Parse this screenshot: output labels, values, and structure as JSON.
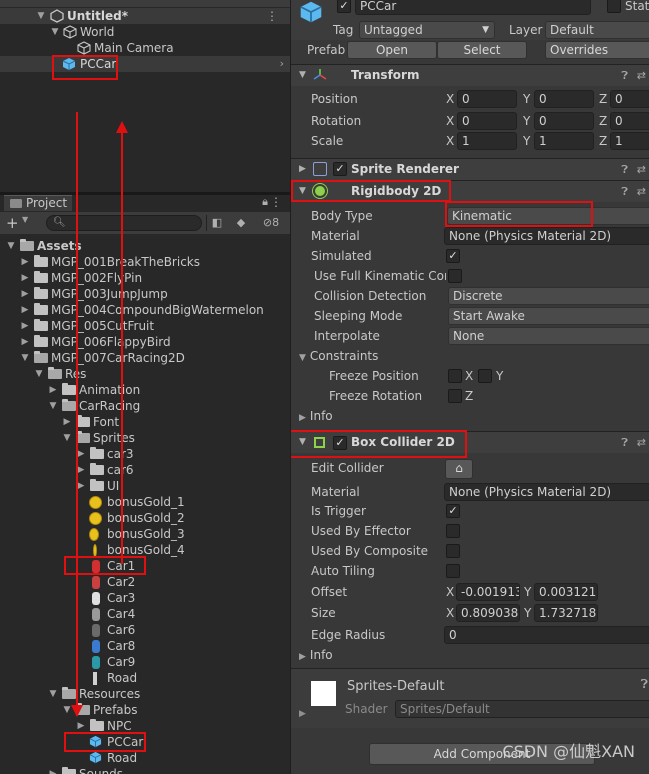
{
  "hierarchy": {
    "scene_name": "Untitled*",
    "items": [
      {
        "label": "World"
      },
      {
        "label": "Main Camera"
      },
      {
        "label": "PCCar"
      }
    ]
  },
  "project": {
    "tab_label": "Project",
    "badge_count": "8",
    "tree": [
      {
        "label": "Assets"
      },
      {
        "label": "MGP_001BreakTheBricks"
      },
      {
        "label": "MGP_002FlyPin"
      },
      {
        "label": "MGP_003JumpJump"
      },
      {
        "label": "MGP_004CompoundBigWatermelon"
      },
      {
        "label": "MGP_005CutFruit"
      },
      {
        "label": "MGP_006FlappyBird"
      },
      {
        "label": "MGP_007CarRacing2D"
      },
      {
        "label": "Res"
      },
      {
        "label": "Animation"
      },
      {
        "label": "CarRacing"
      },
      {
        "label": "Font"
      },
      {
        "label": "Sprites"
      },
      {
        "label": "car3"
      },
      {
        "label": "car6"
      },
      {
        "label": "UI"
      },
      {
        "label": "bonusGold_1"
      },
      {
        "label": "bonusGold_2"
      },
      {
        "label": "bonusGold_3"
      },
      {
        "label": "bonusGold_4"
      },
      {
        "label": "Car1"
      },
      {
        "label": "Car2"
      },
      {
        "label": "Car3"
      },
      {
        "label": "Car4"
      },
      {
        "label": "Car6"
      },
      {
        "label": "Car8"
      },
      {
        "label": "Car9"
      },
      {
        "label": "Road"
      },
      {
        "label": "Resources"
      },
      {
        "label": "Prefabs"
      },
      {
        "label": "NPC"
      },
      {
        "label": "PCCar"
      },
      {
        "label": "Road"
      },
      {
        "label": "Sounds"
      }
    ]
  },
  "inspector": {
    "object_name": "PCCar",
    "static_label": "Stat",
    "tag_label": "Tag",
    "tag_value": "Untagged",
    "layer_label": "Layer",
    "layer_value": "Default",
    "prefab_label": "Prefab",
    "prefab_open": "Open",
    "prefab_select": "Select",
    "prefab_overrides": "Overrides",
    "transform": {
      "title": "Transform",
      "position_label": "Position",
      "rotation_label": "Rotation",
      "scale_label": "Scale",
      "position": [
        "0",
        "0",
        "0"
      ],
      "rotation": [
        "0",
        "0",
        "0"
      ],
      "scale": [
        "1",
        "1",
        "1"
      ]
    },
    "sprite_renderer": {
      "title": "Sprite Renderer"
    },
    "rigidbody": {
      "title": "Rigidbody 2D",
      "body_type_label": "Body Type",
      "body_type_value": "Kinematic",
      "material_label": "Material",
      "material_value": "None (Physics Material 2D)",
      "simulated_label": "Simulated",
      "full_kinematic_label": "Use Full Kinematic Cont",
      "collision_detection_label": "Collision Detection",
      "collision_detection_value": "Discrete",
      "sleeping_mode_label": "Sleeping Mode",
      "sleeping_mode_value": "Start Awake",
      "interpolate_label": "Interpolate",
      "interpolate_value": "None",
      "constraints_label": "Constraints",
      "freeze_position_label": "Freeze Position",
      "freeze_rotation_label": "Freeze Rotation",
      "info_label": "Info"
    },
    "box_collider": {
      "title": "Box Collider 2D",
      "edit_collider_label": "Edit Collider",
      "material_label": "Material",
      "material_value": "None (Physics Material 2D)",
      "is_trigger_label": "Is Trigger",
      "used_by_effector_label": "Used By Effector",
      "used_by_composite_label": "Used By Composite",
      "auto_tiling_label": "Auto Tiling",
      "offset_label": "Offset",
      "offset_x": "-0.001913",
      "offset_y": "0.003121",
      "size_label": "Size",
      "size_x": "0.809038",
      "size_y": "1.732718",
      "edge_radius_label": "Edge Radius",
      "edge_radius_value": "0",
      "info_label": "Info"
    },
    "material_preview": {
      "name": "Sprites-Default",
      "shader_label": "Shader",
      "shader_value": "Sprites/Default"
    },
    "add_component_label": "Add Component"
  },
  "axis_labels": {
    "x": "X",
    "y": "Y",
    "z": "Z"
  },
  "watermark": "CSDN @仙魁XAN",
  "colors": {
    "annotation_red": "#e01010",
    "prefab_blue": "#5cb8f0",
    "rigidbody_green": "#8ed14a"
  }
}
